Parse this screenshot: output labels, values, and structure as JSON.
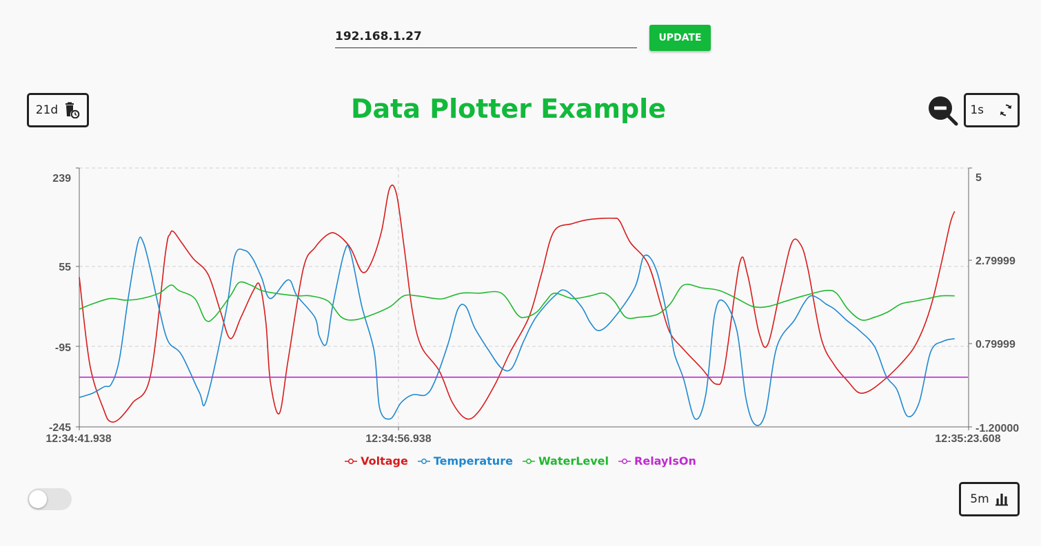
{
  "connection": {
    "ip_value": "192.168.1.27",
    "update_label": "UPDATE"
  },
  "header": {
    "title": "Data Plotter Example",
    "retention_label": "21d",
    "refresh_label": "1s",
    "window_label": "5m"
  },
  "toggle": {
    "on": false
  },
  "colors": {
    "title": "#12b93b",
    "voltage": "#d81b1b",
    "temperature": "#1e88d0",
    "waterlevel": "#1fb82e",
    "relay": "#c02ad0"
  },
  "chart_data": {
    "type": "line",
    "x_ticks": [
      "12:34:41.938",
      "12:34:56.938",
      "12:35:23.608"
    ],
    "x_range": [
      "12:34:41.938",
      "12:35:23.608"
    ],
    "y_left": {
      "ticks": [
        "239",
        "55",
        "-95",
        "-245"
      ],
      "range": [
        -245,
        239
      ]
    },
    "y_right": {
      "ticks": [
        "5",
        "2.79999",
        "0.79999",
        "-1.20000"
      ],
      "range": [
        -1.2,
        5
      ]
    },
    "grid": "dashed horizontal at left ticks, dashed vertical at 12:34:56.938",
    "legend_position": "bottom",
    "series": [
      {
        "name": "Voltage",
        "axis": "left",
        "values": [
          [
            0,
            35
          ],
          [
            1.2,
            -130
          ],
          [
            2.8,
            -215
          ],
          [
            3.5,
            -235
          ],
          [
            4.5,
            -230
          ],
          [
            6,
            -200
          ],
          [
            8,
            -150
          ],
          [
            9.7,
            80
          ],
          [
            10.2,
            115
          ],
          [
            10.6,
            120
          ],
          [
            11.5,
            100
          ],
          [
            12.8,
            70
          ],
          [
            14.5,
            40
          ],
          [
            15.9,
            -30
          ],
          [
            17,
            -80
          ],
          [
            18.2,
            -40
          ],
          [
            19.6,
            10
          ],
          [
            20.3,
            20
          ],
          [
            21,
            -50
          ],
          [
            21.5,
            -160
          ],
          [
            22.5,
            -220
          ],
          [
            23.5,
            -120
          ],
          [
            25.2,
            50
          ],
          [
            26.5,
            90
          ],
          [
            28,
            115
          ],
          [
            29,
            115
          ],
          [
            30.5,
            90
          ],
          [
            31.8,
            45
          ],
          [
            32.8,
            60
          ],
          [
            34,
            120
          ],
          [
            34.9,
            200
          ],
          [
            35.7,
            190
          ],
          [
            36.6,
            85
          ],
          [
            37.5,
            -30
          ],
          [
            38.5,
            -95
          ],
          [
            40.5,
            -140
          ],
          [
            42,
            -200
          ],
          [
            43.6,
            -230
          ],
          [
            45,
            -215
          ],
          [
            46.8,
            -165
          ],
          [
            48.5,
            -105
          ],
          [
            50.6,
            -40
          ],
          [
            52,
            40
          ],
          [
            53.4,
            120
          ],
          [
            55.5,
            135
          ],
          [
            57.5,
            143
          ],
          [
            60,
            145
          ],
          [
            60.8,
            140
          ],
          [
            62,
            100
          ],
          [
            64,
            60
          ],
          [
            65.5,
            -20
          ],
          [
            66.5,
            -70
          ],
          [
            68,
            -100
          ],
          [
            70,
            -135
          ],
          [
            71.7,
            -165
          ],
          [
            72.6,
            -135
          ],
          [
            74.3,
            60
          ],
          [
            75.2,
            40
          ],
          [
            76.5,
            -70
          ],
          [
            77.5,
            -90
          ],
          [
            79,
            20
          ],
          [
            80.2,
            100
          ],
          [
            81.2,
            95
          ],
          [
            82,
            50
          ],
          [
            83.5,
            -80
          ],
          [
            85,
            -130
          ],
          [
            86.5,
            -160
          ],
          [
            87.6,
            -180
          ],
          [
            88.6,
            -180
          ],
          [
            90,
            -165
          ],
          [
            92,
            -135
          ],
          [
            93.8,
            -100
          ],
          [
            95,
            -60
          ],
          [
            96,
            -10
          ],
          [
            97,
            60
          ],
          [
            98,
            135
          ],
          [
            98.5,
            158
          ]
        ]
      },
      {
        "name": "Temperature",
        "axis": "left",
        "values": [
          [
            0,
            -190
          ],
          [
            1.5,
            -182
          ],
          [
            2.8,
            -170
          ],
          [
            3.6,
            -165
          ],
          [
            4.5,
            -120
          ],
          [
            5.5,
            -5
          ],
          [
            6.6,
            100
          ],
          [
            7.2,
            100
          ],
          [
            8,
            50
          ],
          [
            9,
            -25
          ],
          [
            10,
            -85
          ],
          [
            11.5,
            -110
          ],
          [
            13.5,
            -180
          ],
          [
            14.3,
            -195
          ],
          [
            16.5,
            -30
          ],
          [
            17.5,
            75
          ],
          [
            18.6,
            85
          ],
          [
            19.5,
            70
          ],
          [
            20.5,
            35
          ],
          [
            21.5,
            -5
          ],
          [
            23.5,
            30
          ],
          [
            24.5,
            0
          ],
          [
            26.5,
            -40
          ],
          [
            27,
            -75
          ],
          [
            27.8,
            -90
          ],
          [
            28.5,
            -20
          ],
          [
            29.8,
            80
          ],
          [
            30.5,
            83
          ],
          [
            31.8,
            -20
          ],
          [
            33.2,
            -105
          ],
          [
            33.8,
            -210
          ],
          [
            35,
            -230
          ],
          [
            36.2,
            -200
          ],
          [
            37.5,
            -185
          ],
          [
            39,
            -185
          ],
          [
            40,
            -160
          ],
          [
            41.5,
            -90
          ],
          [
            42.6,
            -25
          ],
          [
            43.5,
            -20
          ],
          [
            44.5,
            -60
          ],
          [
            46,
            -100
          ],
          [
            47.5,
            -135
          ],
          [
            48.7,
            -135
          ],
          [
            50,
            -85
          ],
          [
            51.4,
            -40
          ],
          [
            53.5,
            0
          ],
          [
            54.7,
            10
          ],
          [
            56.5,
            -20
          ],
          [
            57.5,
            -50
          ],
          [
            58.5,
            -65
          ],
          [
            60,
            -45
          ],
          [
            62.5,
            15
          ],
          [
            63.6,
            75
          ],
          [
            65,
            45
          ],
          [
            66.5,
            -65
          ],
          [
            67,
            -110
          ],
          [
            68,
            -155
          ],
          [
            69.3,
            -230
          ],
          [
            70.5,
            -185
          ],
          [
            71.5,
            -35
          ],
          [
            72.5,
            -10
          ],
          [
            74,
            -65
          ],
          [
            75,
            -190
          ],
          [
            76,
            -240
          ],
          [
            77.2,
            -220
          ],
          [
            78.5,
            -95
          ],
          [
            80.5,
            -45
          ],
          [
            81.5,
            -15
          ],
          [
            82.3,
            0
          ],
          [
            83.2,
            -5
          ],
          [
            84,
            -15
          ],
          [
            85,
            -25
          ],
          [
            86.3,
            -45
          ],
          [
            87.8,
            -65
          ],
          [
            89.5,
            -95
          ],
          [
            90.8,
            -150
          ],
          [
            92,
            -175
          ],
          [
            93.2,
            -225
          ],
          [
            94.5,
            -200
          ],
          [
            95.8,
            -105
          ],
          [
            97.2,
            -85
          ],
          [
            98.5,
            -80
          ]
        ]
      },
      {
        "name": "WaterLevel",
        "axis": "left",
        "values": [
          [
            0,
            -25
          ],
          [
            1.5,
            -15
          ],
          [
            3.5,
            -5
          ],
          [
            5.2,
            -8
          ],
          [
            7,
            -5
          ],
          [
            9,
            5
          ],
          [
            10.3,
            20
          ],
          [
            11.2,
            10
          ],
          [
            13,
            -5
          ],
          [
            14.2,
            -45
          ],
          [
            15.2,
            -40
          ],
          [
            17,
            0
          ],
          [
            18,
            25
          ],
          [
            19.3,
            20
          ],
          [
            20.5,
            10
          ],
          [
            22,
            5
          ],
          [
            24.5,
            0
          ],
          [
            26,
            0
          ],
          [
            28,
            -10
          ],
          [
            29.5,
            -40
          ],
          [
            31,
            -45
          ],
          [
            33,
            -35
          ],
          [
            35,
            -20
          ],
          [
            36.5,
            0
          ],
          [
            38,
            0
          ],
          [
            40,
            -5
          ],
          [
            41,
            -5
          ],
          [
            43,
            5
          ],
          [
            45,
            5
          ],
          [
            47.5,
            5
          ],
          [
            49.3,
            -35
          ],
          [
            50.2,
            -40
          ],
          [
            51.5,
            -30
          ],
          [
            52.5,
            -10
          ],
          [
            53.5,
            5
          ],
          [
            55.5,
            -5
          ],
          [
            57.5,
            0
          ],
          [
            59,
            5
          ],
          [
            60.2,
            -10
          ],
          [
            61.5,
            -40
          ],
          [
            63,
            -40
          ],
          [
            65,
            -35
          ],
          [
            66.5,
            -15
          ],
          [
            68,
            20
          ],
          [
            70,
            15
          ],
          [
            72,
            10
          ],
          [
            74,
            -5
          ],
          [
            75.8,
            -20
          ],
          [
            77.5,
            -20
          ],
          [
            79.5,
            -10
          ],
          [
            81.5,
            0
          ],
          [
            84,
            10
          ],
          [
            85.2,
            5
          ],
          [
            86.5,
            -25
          ],
          [
            88,
            -45
          ],
          [
            89.5,
            -40
          ],
          [
            91,
            -30
          ],
          [
            92.5,
            -15
          ],
          [
            94,
            -10
          ],
          [
            95.5,
            -5
          ],
          [
            97,
            0
          ],
          [
            98.5,
            0
          ]
        ]
      },
      {
        "name": "RelayIsOn",
        "axis": "left",
        "values": [
          [
            0,
            -152
          ],
          [
            100,
            -152
          ]
        ]
      }
    ]
  }
}
